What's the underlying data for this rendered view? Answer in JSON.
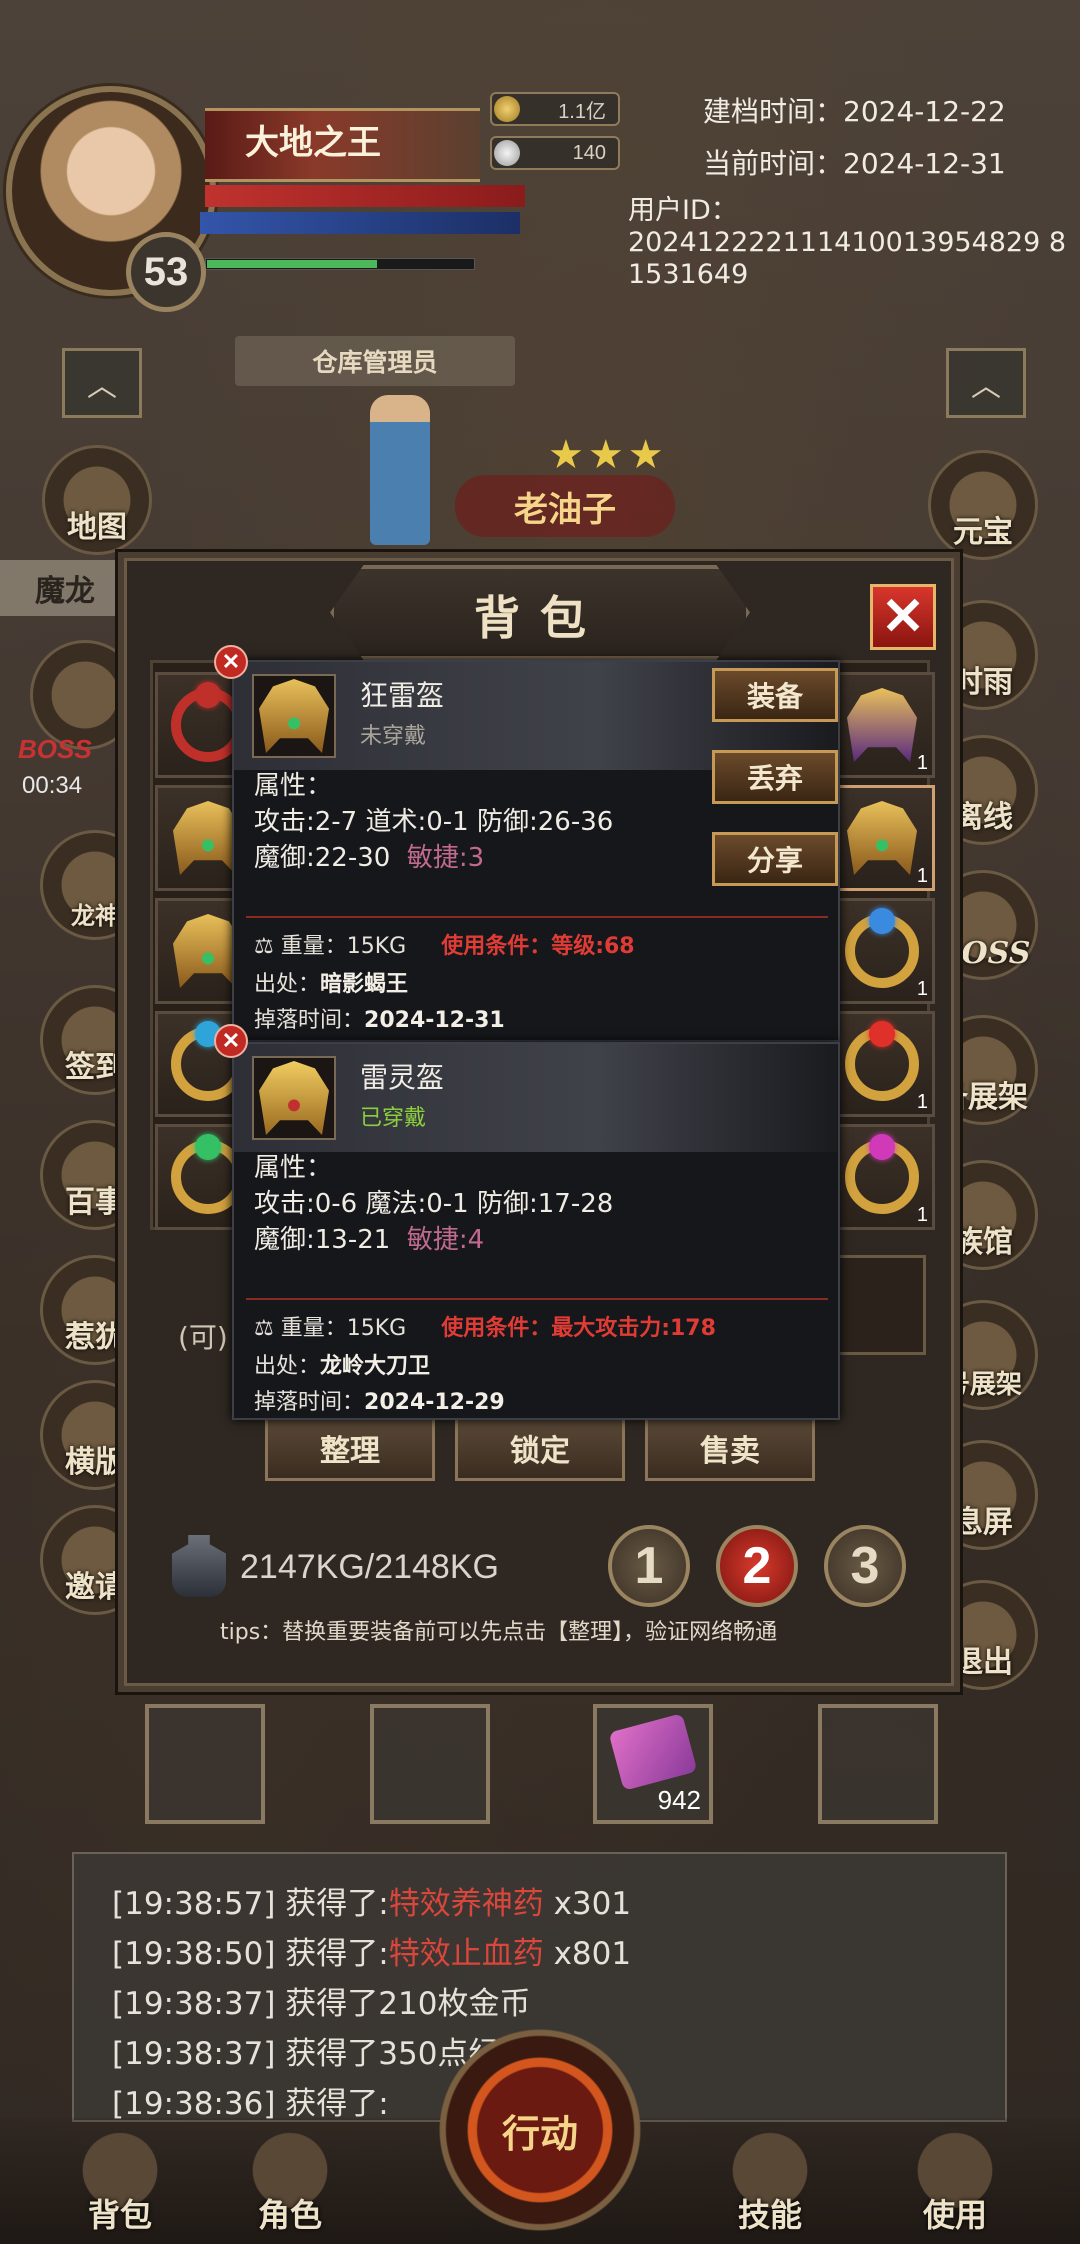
{
  "player": {
    "name": "大地之王",
    "level": "53",
    "title_badge": "仓库管理员",
    "gold": "1.1亿",
    "silver": "140"
  },
  "info": {
    "created_label": "建档时间：",
    "created": "2024-12-22",
    "now_label": "当前时间：",
    "now": "2024-12-31",
    "uid_label": "用户ID：",
    "uid": "202412222111410013954829 81531649"
  },
  "npc": {
    "name": "老油子",
    "stars": "★★★"
  },
  "side_left": {
    "map": "地图",
    "dragon": "魔龙",
    "boss": "BOSS",
    "timer": "00:34",
    "dragon_god": "龙神",
    "sign": "签到",
    "hundred": "百事",
    "hui": "惹犹",
    "horizontal": "横版",
    "invite": "邀请"
  },
  "side_right": {
    "yuanbao": "元宝",
    "timerain": "时雨",
    "offline": "离线",
    "boss": "BOSS",
    "shelf": "备展架",
    "clan": "族馆",
    "number_shelf": "号展架",
    "screen": "息屏",
    "exit": "退出"
  },
  "bag": {
    "title": "背包",
    "close": "✕",
    "can_place": "(可)",
    "buttons": {
      "sort": "整理",
      "lock": "锁定",
      "sell": "售卖"
    },
    "weight": "2147KG/2148KG",
    "pages": [
      "1",
      "2",
      "3"
    ],
    "tips": "tips：替换重要装备前可以先点击【整理】，验证网络畅通",
    "slot_count": "1"
  },
  "tooltip1": {
    "name": "狂雷盔",
    "state": "未穿戴",
    "attr_title": "属性：",
    "line1": "攻击:2-7  道术:0-1  防御:26-36",
    "line2_main": "魔御:22-30",
    "line2_extra": "敏捷:3",
    "weight": "重量：15KG",
    "cond": "使用条件：等级:68",
    "source_label": "出处：",
    "source": "暗影蝎王",
    "drop_label": "掉落时间：",
    "drop": "2024-12-31",
    "actions": {
      "equip": "装备",
      "discard": "丢弃",
      "share": "分享"
    }
  },
  "tooltip2": {
    "name": "雷灵盔",
    "state": "已穿戴",
    "attr_title": "属性：",
    "line1": "攻击:0-6  魔法:0-1  防御:17-28",
    "line2_main": "魔御:13-21",
    "line2_extra": "敏捷:4",
    "weight": "重量：15KG",
    "cond": "使用条件：最大攻击力:178",
    "source_label": "出处：",
    "source": "龙岭大刀卫",
    "drop_label": "掉落时间：",
    "drop": "2024-12-29"
  },
  "quickbar": {
    "scroll_count": "942"
  },
  "chat": [
    {
      "time": "[19:38:57] 获得了:",
      "item": "特效养神药",
      "qty": " x301"
    },
    {
      "time": "[19:38:50] 获得了:",
      "item": "特效止血药",
      "qty": " x801"
    },
    {
      "time": "[19:38:37] 获得了210枚金币",
      "item": "",
      "qty": ""
    },
    {
      "time": "[19:38:37] 获得了350点经",
      "item": "",
      "qty": ""
    },
    {
      "time": "[19:38:36] 获得了:",
      "item": "",
      "qty": ""
    }
  ],
  "nav": {
    "bag": "背包",
    "role": "角色",
    "action": "行动",
    "skill": "技能",
    "use": "使用"
  }
}
